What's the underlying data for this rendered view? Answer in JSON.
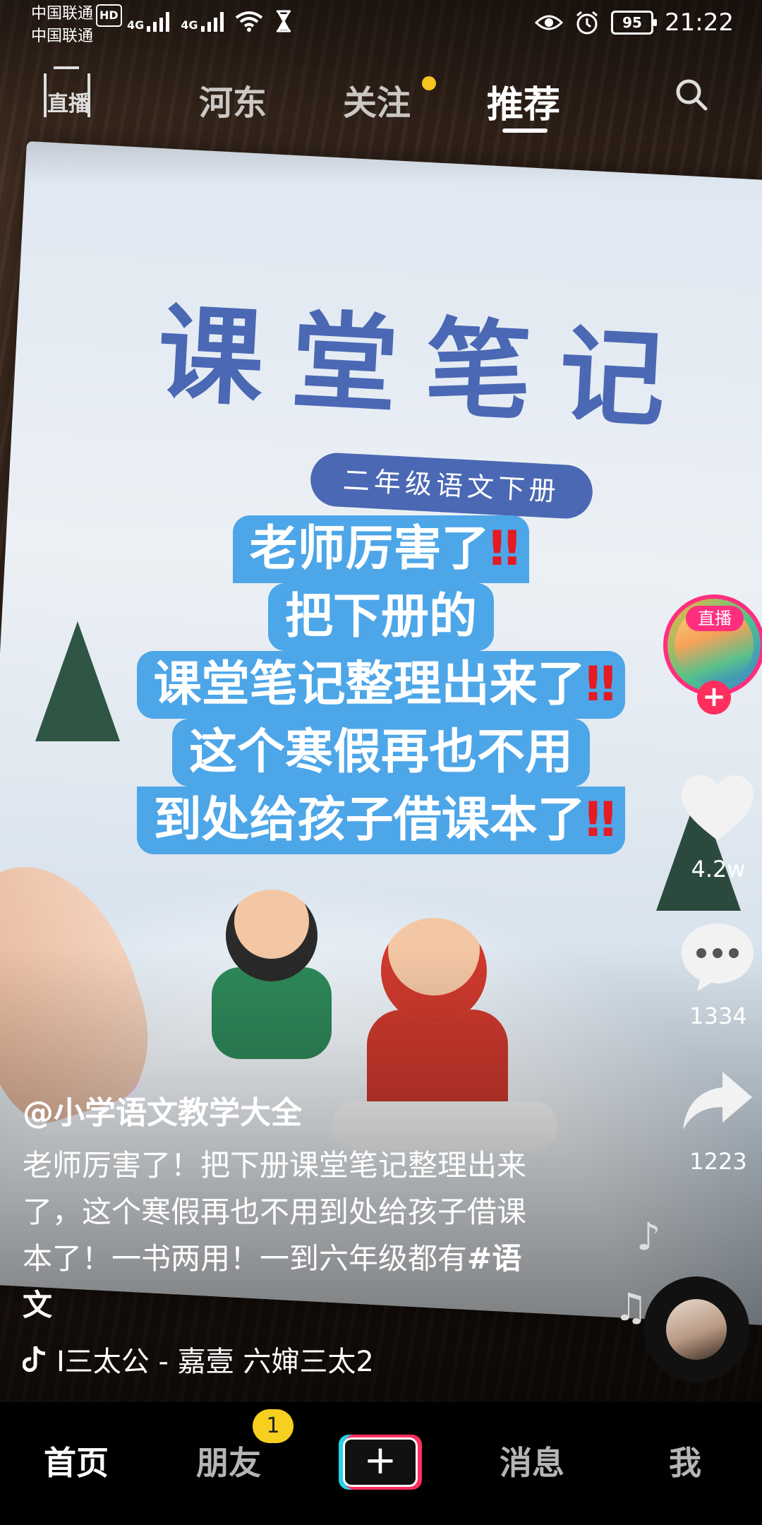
{
  "status_bar": {
    "carrier_1": "中国联通",
    "carrier_2": "中国联通",
    "hd_badge": "HD",
    "net_1": "4G",
    "net_2": "4G",
    "battery": "95",
    "time": "21:22"
  },
  "top_nav": {
    "live_label": "直播",
    "tabs": [
      {
        "label": "河东"
      },
      {
        "label": "关注"
      },
      {
        "label": "推荐",
        "active": true
      }
    ]
  },
  "caption": {
    "lines": [
      "老师厉害了",
      "把下册的",
      "课堂笔记整理出来了",
      "这个寒假再也不用",
      "到处给孩子借课本了"
    ],
    "bang": "‼"
  },
  "book": {
    "title": "课堂笔记",
    "subtitle": "二年级语文下册"
  },
  "side_actions": {
    "live_badge": "直播",
    "follow_plus": "+",
    "likes": "4.2w",
    "comments": "1334",
    "shares": "1223"
  },
  "post": {
    "author": "@小学语文教学大全",
    "description": "老师厉害了！把下册课堂笔记整理出来了，这个寒假再也不用到处给孩子借课本了！一书两用！一到六年级都有",
    "tag": "#语文",
    "music": "I三太公 - 嘉壹    六婶三太2"
  },
  "bottom_bar": {
    "home": "首页",
    "friends": "朋友",
    "friends_badge": "1",
    "create": "+",
    "messages": "消息",
    "me": "我"
  },
  "colors": {
    "accent_pink": "#ff2e5e",
    "caption_bg": "#4da6e8",
    "badge_yellow": "#f7d01f"
  }
}
